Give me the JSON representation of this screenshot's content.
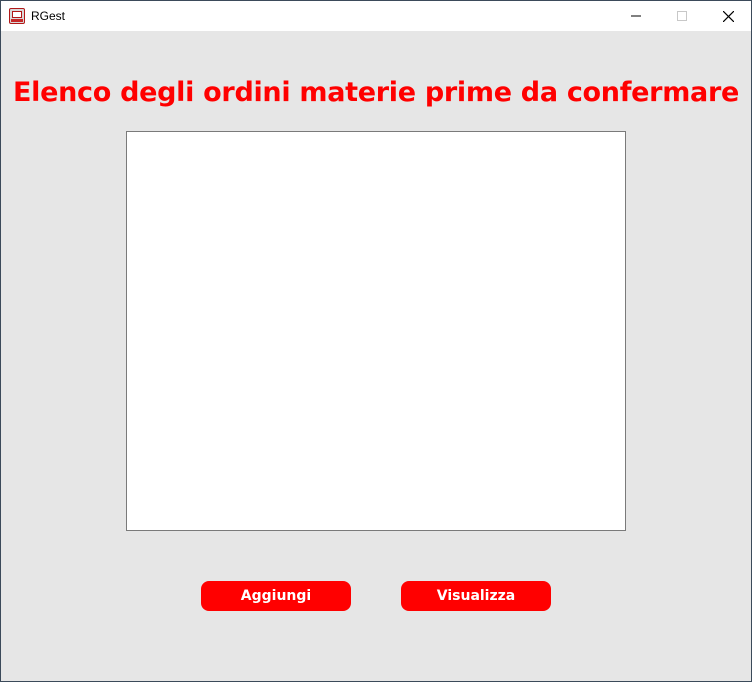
{
  "window": {
    "title": "RGest",
    "icon": "app-icon"
  },
  "controls": {
    "minimize_icon": "minimize-icon",
    "maximize_icon": "maximize-icon",
    "close_icon": "close-icon"
  },
  "main": {
    "heading": "Elenco degli ordini materie prime da confermare",
    "list_items": []
  },
  "buttons": {
    "add_label": "Aggiungi",
    "view_label": "Visualizza"
  },
  "colors": {
    "accent": "#ff0000",
    "background": "#e6e6e6",
    "titlebar": "#ffffff",
    "list_background": "#ffffff"
  }
}
